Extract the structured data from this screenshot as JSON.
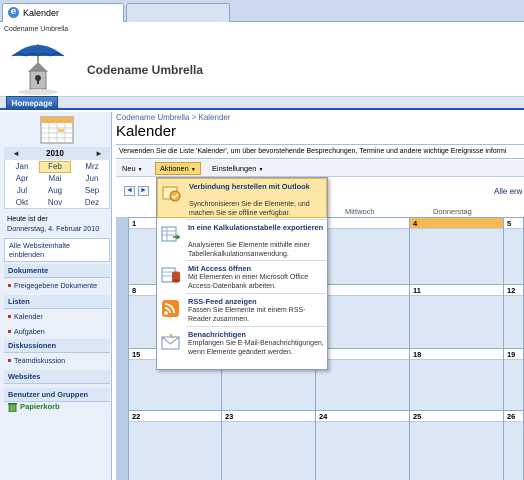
{
  "browser": {
    "tab_title": "Kalender"
  },
  "site": {
    "label": "Codename Umbrella",
    "title": "Codename Umbrella",
    "home_tab": "Homepage"
  },
  "datepicker": {
    "year": "2010",
    "prev": "◄",
    "next": "►",
    "months": [
      "Jan",
      "Feb",
      "Mrz",
      "Apr",
      "Mai",
      "Jun",
      "Jul",
      "Aug",
      "Sep",
      "Okt",
      "Nov",
      "Dez"
    ],
    "selected_month": "Feb"
  },
  "today": {
    "line1": "Heute ist der",
    "line2": "Donnerstag, 4. Februar 2010"
  },
  "leftnav": {
    "all_content": "Alle Websiteinhalte einblenden",
    "sections": [
      {
        "head": "Dokumente",
        "items": [
          "Freigegebene Dokumente"
        ]
      },
      {
        "head": "Listen",
        "items": [
          "Kalender",
          "Aufgaben"
        ]
      },
      {
        "head": "Diskussionen",
        "items": [
          "Teamdiskussion"
        ]
      },
      {
        "head": "Websites",
        "items": []
      },
      {
        "head": "Benutzer und Gruppen",
        "items": []
      }
    ],
    "recycle_bin": "Papierkorb"
  },
  "main": {
    "breadcrumb": "Codename Umbrella > Kalender",
    "title": "Kalender",
    "description": "Verwenden Sie die Liste 'Kalender', um über bevorstehende Besprechungen, Termine und andere wichtige Ereignisse informi",
    "toolbar": {
      "new": "Neu",
      "actions": "Aktionen",
      "settings": "Einstellungen",
      "dropdown_glyph": "▼"
    },
    "all_events": "Alle erw",
    "weekdays": {
      "wed": "Mittwoch",
      "thu": "Donnerstag"
    }
  },
  "calendar": {
    "rows": [
      [
        "1",
        "",
        "",
        "4",
        "5"
      ],
      [
        "8",
        "",
        "",
        "11",
        "12"
      ],
      [
        "15",
        "",
        "",
        "18",
        "19"
      ],
      [
        "22",
        "23",
        "24",
        "25",
        "26"
      ]
    ],
    "today_cell": "4"
  },
  "menu": {
    "items": [
      {
        "title": "Verbindung herstellen mit Outlook",
        "desc": "Synchronisieren Sie die Elemente, und machen Sie sie offline verfügbar.",
        "icon": "outlook-connect-icon"
      },
      {
        "title": "In eine Kalkulationstabelle exportieren",
        "desc": "Analysieren Sie Elemente mithilfe einer Tabellenkalkulationsanwendung.",
        "icon": "spreadsheet-export-icon"
      },
      {
        "title": "Mit Access öffnen",
        "desc": "Mit Elementen in einer Microsoft Office Access-Datenbank arbeiten.",
        "icon": "access-icon"
      },
      {
        "title": "RSS-Feed anzeigen",
        "desc": "Fassen Sie Elemente mit einem RSS-Reader zusammen.",
        "icon": "rss-icon"
      },
      {
        "title": "Benachrichtigen",
        "desc": "Empfangen Sie E-Mail-Benachrichtigungen, wenn Elemente geändert werden.",
        "icon": "alert-envelope-icon"
      }
    ]
  }
}
